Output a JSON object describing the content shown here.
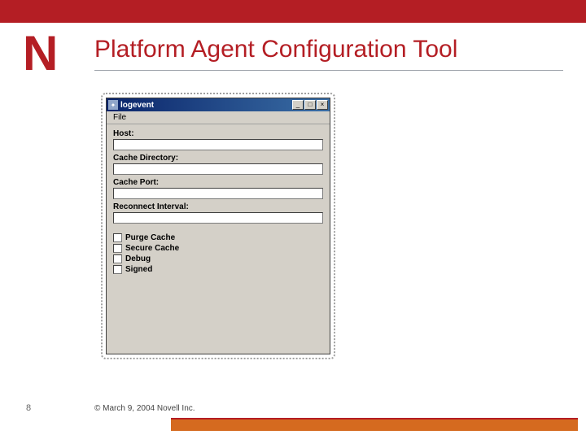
{
  "brand": {
    "logo_letter": "N"
  },
  "slide": {
    "title": "Platform Agent Configuration Tool",
    "page_number": "8",
    "footer": "© March 9, 2004 Novell Inc."
  },
  "window": {
    "title": "logevent",
    "menubar": {
      "file": "File"
    },
    "controls": {
      "minimize": "_",
      "maximize": "□",
      "close": "×"
    },
    "fields": {
      "host_label": "Host:",
      "host_value": "",
      "cache_dir_label": "Cache Directory:",
      "cache_dir_value": "",
      "cache_port_label": "Cache Port:",
      "cache_port_value": "",
      "reconnect_label": "Reconnect Interval:",
      "reconnect_value": ""
    },
    "checkboxes": {
      "purge_cache": "Purge Cache",
      "secure_cache": "Secure Cache",
      "debug": "Debug",
      "signed": "Signed"
    }
  }
}
